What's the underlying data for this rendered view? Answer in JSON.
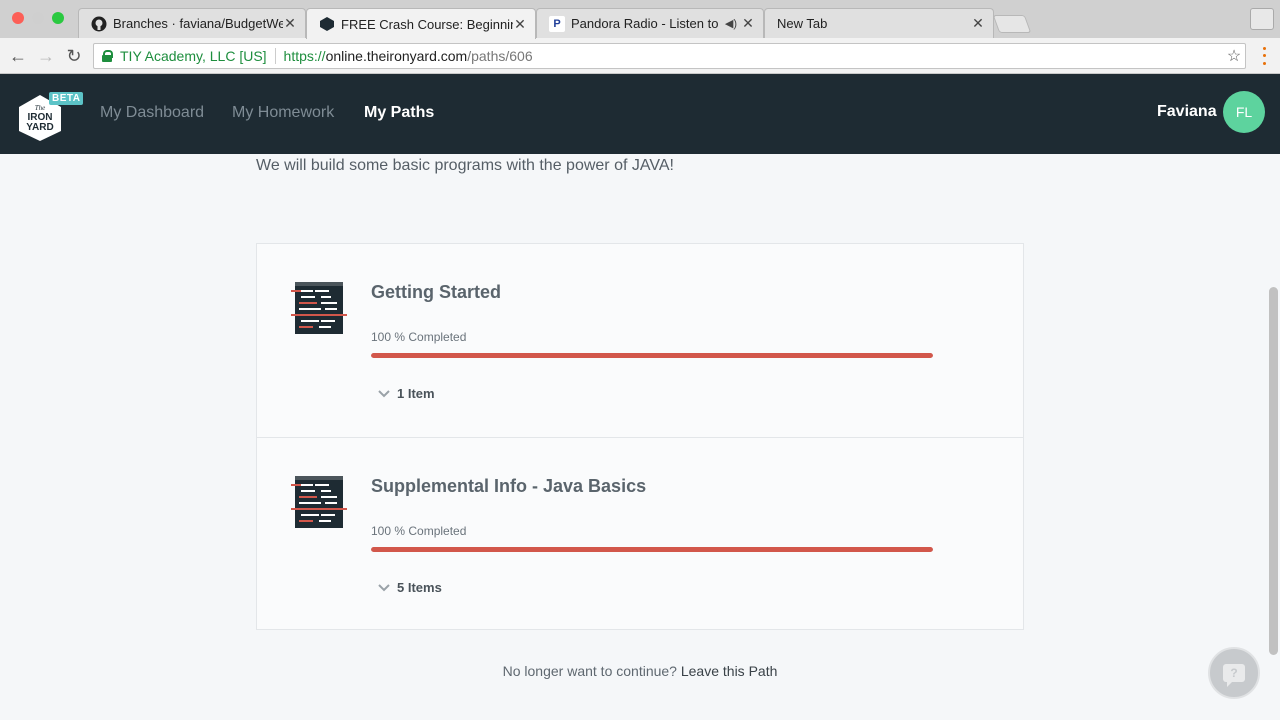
{
  "browser": {
    "tabs": [
      {
        "title": "Branches · faviana/BudgetWeb",
        "favicon": "github-icon",
        "active": false
      },
      {
        "title": "FREE Crash Course: Beginning",
        "favicon": "ironyard-icon",
        "active": true
      },
      {
        "title": "Pandora Radio - Listen to Fr",
        "favicon": "pandora-icon",
        "active": false,
        "audio": true
      },
      {
        "title": "New Tab",
        "favicon": "",
        "active": false
      }
    ],
    "address": {
      "ev_label": "TIY Academy, LLC [US]",
      "scheme": "https://",
      "host": "online.theironyard.com",
      "path": "/paths/606"
    }
  },
  "header": {
    "logo_alt": "The Iron Yard",
    "beta": "BETA",
    "nav": [
      {
        "label": "My Dashboard",
        "active": false
      },
      {
        "label": "My Homework",
        "active": false
      },
      {
        "label": "My Paths",
        "active": true
      }
    ],
    "user_name": "Faviana",
    "avatar_initials": "FL"
  },
  "intro_text": "We will build some basic programs with the power of JAVA!",
  "modules": [
    {
      "title": "Getting Started",
      "percent_label": "100 % Completed",
      "progress": 1.0,
      "items_label": "1 Item"
    },
    {
      "title": "Supplemental Info - Java Basics",
      "percent_label": "100 % Completed",
      "progress": 1.0,
      "items_label": "5 Items"
    }
  ],
  "leave": {
    "prompt": "No longer want to continue?",
    "link": "Leave this Path"
  },
  "colors": {
    "header_bg": "#1e2b33",
    "progress": "#d2574b",
    "avatar": "#5dd39e",
    "beta": "#5cc3c7"
  }
}
